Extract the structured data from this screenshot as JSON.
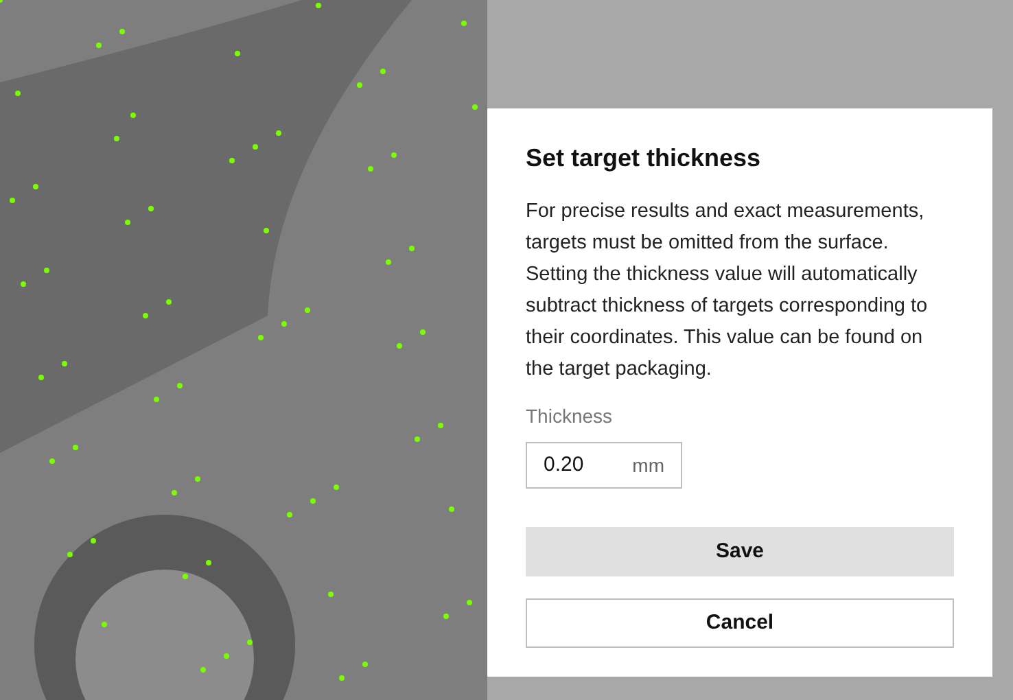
{
  "dialog": {
    "title": "Set target thickness",
    "description": "For precise results and exact measurements, targets must be omitted from the surface. Setting the thickness value will automatically subtract thickness of targets corresponding to their coordinates. This value can be found on the target packaging.",
    "field": {
      "label": "Thickness",
      "value": "0.20",
      "unit": "mm"
    },
    "buttons": [
      {
        "label": "Save",
        "kind": "primary"
      },
      {
        "label": "Cancel",
        "kind": "secondary"
      }
    ]
  }
}
